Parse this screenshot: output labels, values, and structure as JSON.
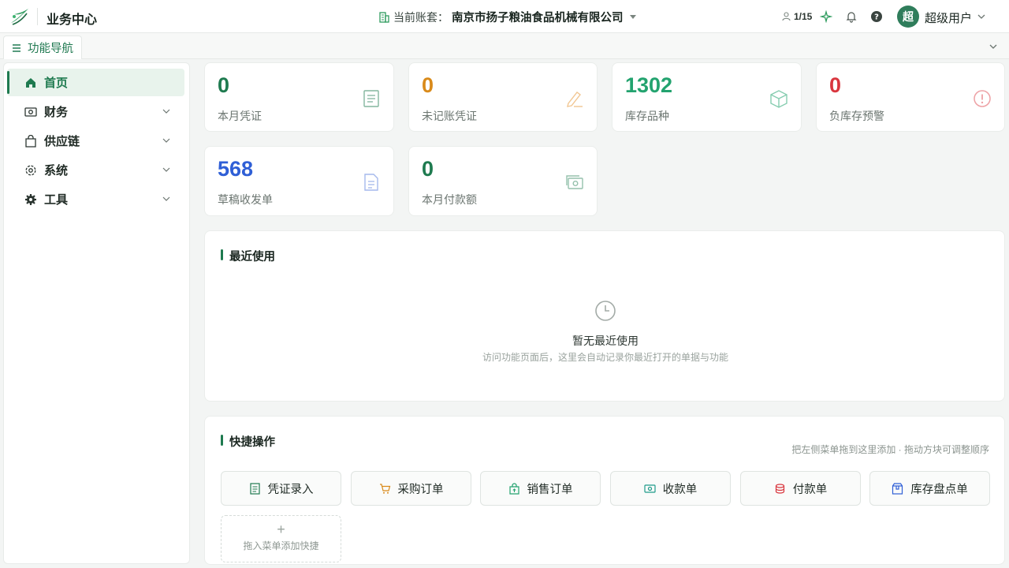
{
  "header": {
    "app_title": "业务中心",
    "account_label": "当前账套：",
    "account_name": "南京市扬子粮油食品机械有限公司",
    "user_count": "1/15",
    "avatar_text": "超",
    "user_name": "超级用户"
  },
  "subnav": {
    "tab_label": "功能导航"
  },
  "sidebar": {
    "items": [
      {
        "label": "首页",
        "icon": "home-icon",
        "active": true
      },
      {
        "label": "财务",
        "icon": "money-icon"
      },
      {
        "label": "供应链",
        "icon": "bag-icon"
      },
      {
        "label": "系统",
        "icon": "gear-icon"
      },
      {
        "label": "工具",
        "icon": "cog-icon"
      }
    ]
  },
  "stats": [
    {
      "value": "0",
      "label": "本月凭证",
      "color": "#1e7a4f",
      "icon": "document-icon"
    },
    {
      "value": "0",
      "label": "未记账凭证",
      "color": "#d98a1a",
      "icon": "pencil-icon"
    },
    {
      "value": "1302",
      "label": "库存品种",
      "color": "#23a36f",
      "icon": "box-icon"
    },
    {
      "value": "0",
      "label": "负库存预警",
      "color": "#d9363e",
      "icon": "alert-icon"
    },
    {
      "value": "568",
      "label": "草稿收发单",
      "color": "#2f5fd6",
      "icon": "file-icon"
    },
    {
      "value": "0",
      "label": "本月付款额",
      "color": "#1e7a4f",
      "icon": "cash-icon"
    }
  ],
  "recent": {
    "title": "最近使用",
    "empty_title": "暂无最近使用",
    "empty_sub": "访问功能页面后，这里会自动记录你最近打开的单据与功能"
  },
  "quick": {
    "title": "快捷操作",
    "hint": "把左侧菜单拖到这里添加 · 拖动方块可调整顺序",
    "buttons": [
      {
        "label": "凭证录入",
        "icon": "voucher-icon"
      },
      {
        "label": "采购订单",
        "icon": "cart-icon"
      },
      {
        "label": "销售订单",
        "icon": "sale-bag-icon"
      },
      {
        "label": "收款单",
        "icon": "receipt-icon"
      },
      {
        "label": "付款单",
        "icon": "coins-icon"
      },
      {
        "label": "库存盘点单",
        "icon": "inventory-icon"
      }
    ],
    "add_plus": "+",
    "add_label": "拖入菜单添加快捷"
  },
  "colors": {
    "accent": "#1e7a4f",
    "avatar": "#2f7d5b"
  }
}
